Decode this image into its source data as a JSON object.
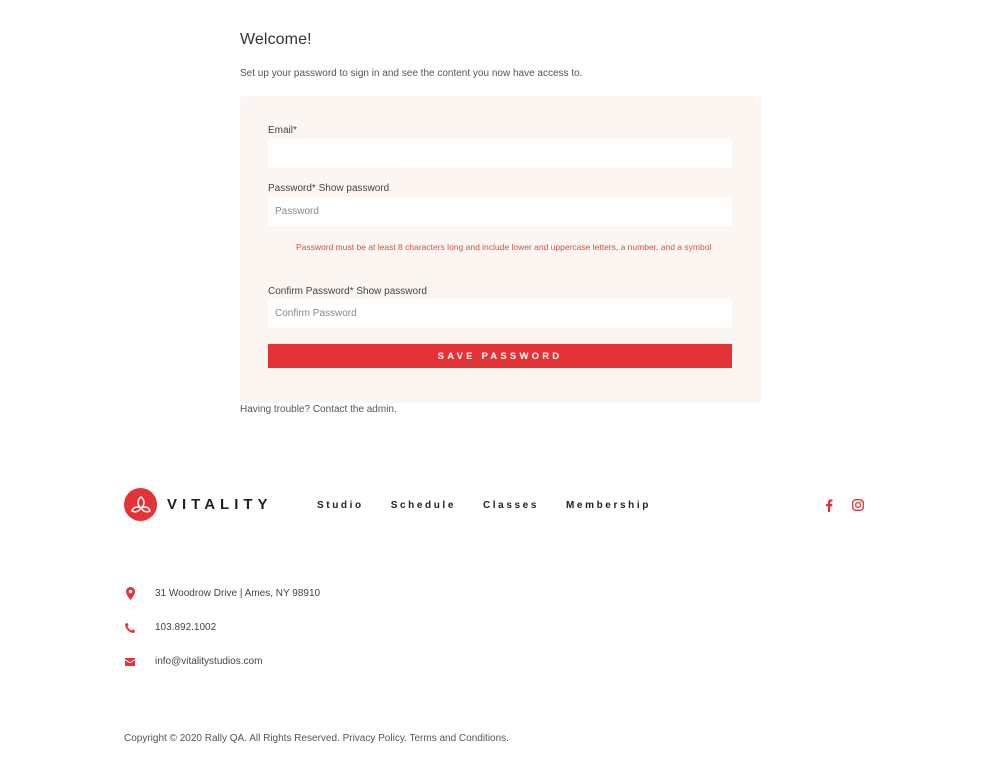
{
  "page": {
    "welcome": "Welcome!",
    "intro": "Set up your password to sign in and see the content you now have access to."
  },
  "form": {
    "email_label": "Email*",
    "email_value": "",
    "password_label": "Password*",
    "show_password": "Show password",
    "password_placeholder": "Password",
    "password_hint": "Password must be at least 8 characters long and include lower and uppercase letters, a number, and a symbol",
    "confirm_label": "Confirm Password*",
    "confirm_placeholder": "Confirm Password",
    "save_button": "SAVE PASSWORD"
  },
  "help": {
    "prefix": "Having trouble? ",
    "link": "Contact the admin."
  },
  "footer": {
    "brand": "VITALITY",
    "nav": [
      "Studio",
      "Schedule",
      "Classes",
      "Membership"
    ],
    "social_icons": [
      "facebook-icon",
      "instagram-icon"
    ],
    "address": "31 Woodrow Drive | Ames, NY 98910",
    "phone": "103.892.1002",
    "email": "info@vitalitystudios.com",
    "copyright": "Copyright © 2020 Rally QA. All Rights Reserved.",
    "privacy": "Privacy Policy.",
    "terms": "Terms and Conditions."
  },
  "colors": {
    "accent": "#e33336",
    "card_bg": "#fbf6f2",
    "hint": "#d4543e"
  }
}
